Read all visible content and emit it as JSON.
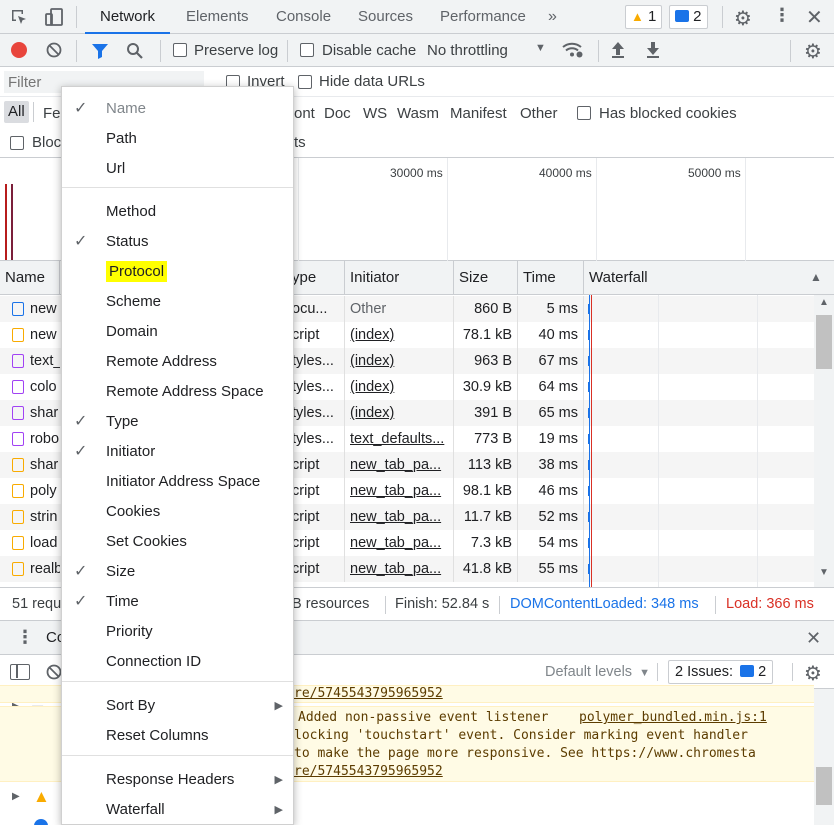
{
  "tabs": [
    "Network",
    "Elements",
    "Console",
    "Sources",
    "Performance"
  ],
  "more_tabs": "»",
  "warnings_count": "1",
  "issues_count": "2",
  "toolbar": {
    "preserve_log": "Preserve log",
    "disable_cache": "Disable cache",
    "throttling": "No throttling"
  },
  "filter": {
    "placeholder": "Filter",
    "invert": "Invert",
    "hide_data_urls": "Hide data URLs",
    "all": "All",
    "fe_partial": "Fe",
    "types_visible": [
      "ont",
      "Doc",
      "WS",
      "Wasm",
      "Manifest",
      "Other"
    ],
    "has_blocked_cookies": "Has blocked cookies",
    "blocked_partial": "Bloc",
    "blocked_tail": "ts"
  },
  "overview": {
    "ticks": [
      "30000 ms",
      "40000 ms",
      "50000 ms"
    ]
  },
  "table": {
    "headers": {
      "name": "Name",
      "type": "ype",
      "initiator": "Initiator",
      "size": "Size",
      "time": "Time",
      "waterfall": "Waterfall"
    },
    "rows": [
      {
        "name": "new",
        "type": "ocu...",
        "initiator": "Other",
        "size": "860 B",
        "time": "5 ms",
        "kind": "doc"
      },
      {
        "name": "new",
        "type": "cript",
        "initiator": "(index)",
        "size": "78.1 kB",
        "time": "40 ms",
        "kind": "script"
      },
      {
        "name": "text_",
        "type": "tyles...",
        "initiator": "(index)",
        "size": "963 B",
        "time": "67 ms",
        "kind": "style"
      },
      {
        "name": "colo",
        "type": "tyles...",
        "initiator": "(index)",
        "size": "30.9 kB",
        "time": "64 ms",
        "kind": "style"
      },
      {
        "name": "shar",
        "type": "tyles...",
        "initiator": "(index)",
        "size": "391 B",
        "time": "65 ms",
        "kind": "style"
      },
      {
        "name": "robo",
        "type": "tyles...",
        "initiator": "text_defaults...",
        "size": "773 B",
        "time": "19 ms",
        "kind": "style"
      },
      {
        "name": "shar",
        "type": "cript",
        "initiator": "new_tab_pa...",
        "size": "113 kB",
        "time": "38 ms",
        "kind": "script"
      },
      {
        "name": "poly",
        "type": "cript",
        "initiator": "new_tab_pa...",
        "size": "98.1 kB",
        "time": "46 ms",
        "kind": "script"
      },
      {
        "name": "strin",
        "type": "cript",
        "initiator": "new_tab_pa...",
        "size": "11.7 kB",
        "time": "52 ms",
        "kind": "script"
      },
      {
        "name": "load",
        "type": "cript",
        "initiator": "new_tab_pa...",
        "size": "7.3 kB",
        "time": "54 ms",
        "kind": "script"
      },
      {
        "name": "realb",
        "type": "cript",
        "initiator": "new_tab_pa...",
        "size": "41.8 kB",
        "time": "55 ms",
        "kind": "script"
      }
    ]
  },
  "status": {
    "requests_partial": "51 requ",
    "resources_partial": "B resources",
    "finish": "Finish: 52.84 s",
    "dom_content_loaded": "DOMContentLoaded: 348 ms",
    "load": "Load: 366 ms"
  },
  "drawer": {
    "tab_partial": "Co"
  },
  "console": {
    "default_levels": "Default levels",
    "issues_label": "2 Issues:",
    "issues_count": "2",
    "lines": [
      "re/5745543795965952",
      "Added non-passive event listener",
      "locking 'touchstart' event. Consider marking event handler",
      "to make the page more responsive. See https://www.chromesta",
      "re/5745543795965952"
    ],
    "source_link": "polymer_bundled.min.js:1"
  },
  "context_menu": {
    "items": [
      {
        "label": "Name",
        "checked": true,
        "disabled": true
      },
      {
        "label": "Path",
        "checked": false
      },
      {
        "label": "Url",
        "checked": false
      },
      {
        "label": "Method",
        "checked": false
      },
      {
        "label": "Status",
        "checked": true
      },
      {
        "label": "Protocol",
        "checked": false,
        "highlighted": true
      },
      {
        "label": "Scheme",
        "checked": false
      },
      {
        "label": "Domain",
        "checked": false
      },
      {
        "label": "Remote Address",
        "checked": false
      },
      {
        "label": "Remote Address Space",
        "checked": false
      },
      {
        "label": "Type",
        "checked": true
      },
      {
        "label": "Initiator",
        "checked": true
      },
      {
        "label": "Initiator Address Space",
        "checked": false
      },
      {
        "label": "Cookies",
        "checked": false
      },
      {
        "label": "Set Cookies",
        "checked": false
      },
      {
        "label": "Size",
        "checked": true
      },
      {
        "label": "Time",
        "checked": true
      },
      {
        "label": "Priority",
        "checked": false
      },
      {
        "label": "Connection ID",
        "checked": false
      },
      {
        "label": "Sort By",
        "submenu": true
      },
      {
        "label": "Reset Columns"
      },
      {
        "label": "Response Headers",
        "submenu": true
      },
      {
        "label": "Waterfall",
        "submenu": true
      }
    ]
  },
  "colors": {
    "accent": "#1a73e8",
    "record_red": "#e8453c",
    "highlight": "#ffff00",
    "load_red": "#d93025",
    "dcl_blue": "#1a73e8"
  }
}
